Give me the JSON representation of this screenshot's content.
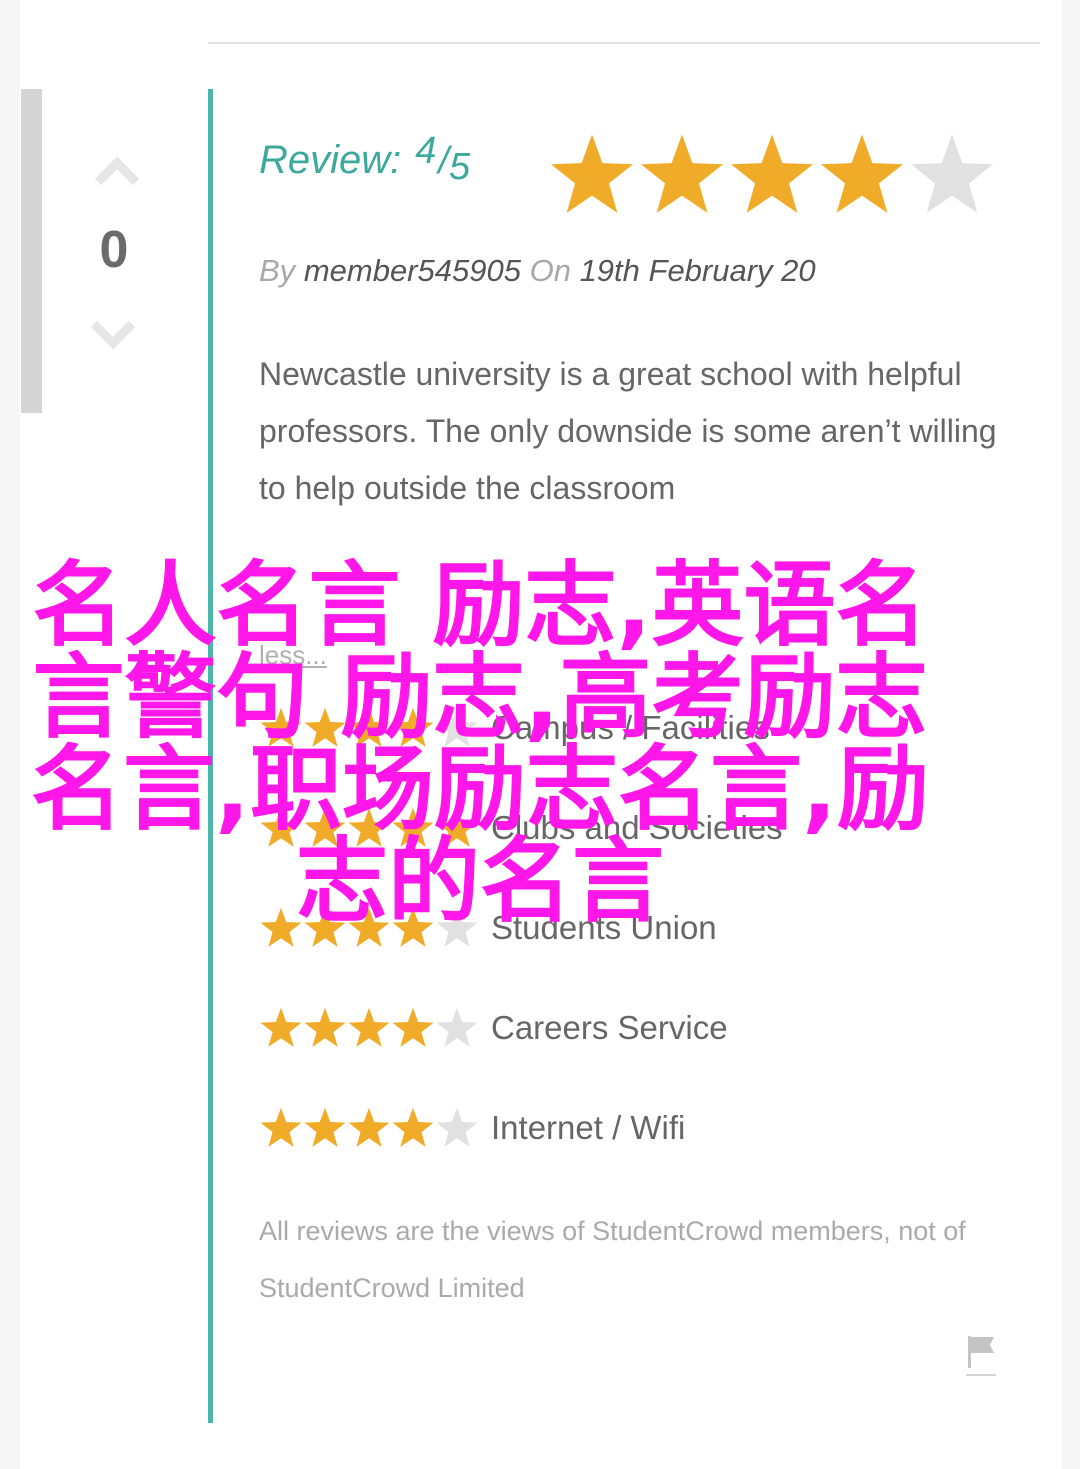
{
  "vote": {
    "count": "0"
  },
  "review": {
    "label": "Review:",
    "score": "4",
    "separator": "/",
    "max": "5",
    "stars_filled": 4,
    "stars_total": 5
  },
  "byline": {
    "by": "By",
    "author": "member545905",
    "on": "On",
    "date": "19th February 20"
  },
  "body": {
    "text": "Newcastle university is a great school with helpful professors. The only downside is some aren’t willing to help outside the classroom",
    "less_link": "less..."
  },
  "ratings": [
    {
      "label": "Campus / Facilities",
      "stars": 4
    },
    {
      "label": "Clubs and Societies",
      "stars": 5
    },
    {
      "label": "Students Union",
      "stars": 4
    },
    {
      "label": "Careers Service",
      "stars": 4
    },
    {
      "label": "Internet / Wifi",
      "stars": 4
    }
  ],
  "disclaimer": "All reviews are the views of StudentCrowd members, not of StudentCrowd Limited",
  "watermark": "名人名言 励志,英语名言警句 励志,高考励志名言,职场励志名言,励志的名言",
  "colors": {
    "accent": "#4db6ac",
    "star_filled": "#f0ac28",
    "star_empty": "#e1e1e1",
    "watermark": "#ff16e8"
  },
  "icons": {
    "vote_up": "chevron-up-icon",
    "vote_down": "chevron-down-icon",
    "flag": "flag-icon",
    "star": "star-icon"
  }
}
